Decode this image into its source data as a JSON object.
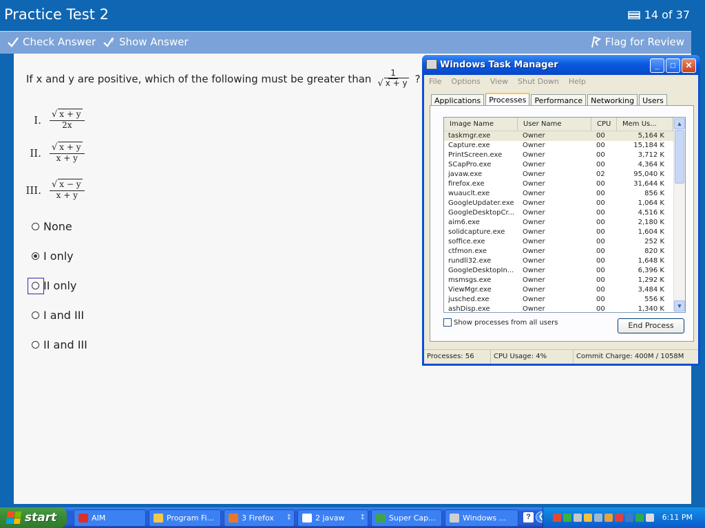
{
  "header": {
    "title": "Practice Test 2",
    "counter": "14 of 37"
  },
  "toolbar": {
    "check_answer": "Check Answer",
    "show_answer": "Show Answer",
    "flag_review": "Flag for Review"
  },
  "question": {
    "text": "If x and y are positive, which of the following must be greater than",
    "target_num": "1",
    "target_den": "x + y",
    "qmark": "?",
    "items": [
      {
        "label": "I.",
        "num": "x + y",
        "den": "2x"
      },
      {
        "label": "II.",
        "num": "x + y",
        "den": "x + y"
      },
      {
        "label": "III.",
        "num": "x − y",
        "den": "x + y"
      }
    ]
  },
  "choices": [
    {
      "label": "None",
      "selected": false
    },
    {
      "label": "I only",
      "selected": true
    },
    {
      "label": "II only",
      "selected": false
    },
    {
      "label": "I and III",
      "selected": false
    },
    {
      "label": "II and III",
      "selected": false
    }
  ],
  "taskmgr": {
    "title": "Windows Task Manager",
    "menu": [
      "File",
      "Options",
      "View",
      "Shut Down",
      "Help"
    ],
    "tabs": [
      "Applications",
      "Processes",
      "Performance",
      "Networking",
      "Users"
    ],
    "active_tab": "Processes",
    "columns": [
      "Image Name",
      "User Name",
      "CPU",
      "Mem Us..."
    ],
    "rows": [
      [
        "taskmgr.exe",
        "Owner",
        "00",
        "5,164 K"
      ],
      [
        "Capture.exe",
        "Owner",
        "00",
        "15,184 K"
      ],
      [
        "PrintScreen.exe",
        "Owner",
        "00",
        "3,712 K"
      ],
      [
        "SCapPro.exe",
        "Owner",
        "00",
        "4,364 K"
      ],
      [
        "javaw.exe",
        "Owner",
        "02",
        "95,040 K"
      ],
      [
        "firefox.exe",
        "Owner",
        "00",
        "31,644 K"
      ],
      [
        "wuauclt.exe",
        "Owner",
        "00",
        "856 K"
      ],
      [
        "GoogleUpdater.exe",
        "Owner",
        "00",
        "1,064 K"
      ],
      [
        "GoogleDesktopCr...",
        "Owner",
        "00",
        "4,516 K"
      ],
      [
        "aim6.exe",
        "Owner",
        "00",
        "2,180 K"
      ],
      [
        "solidcapture.exe",
        "Owner",
        "00",
        "1,604 K"
      ],
      [
        "soffice.exe",
        "Owner",
        "00",
        "252 K"
      ],
      [
        "ctfmon.exe",
        "Owner",
        "00",
        "820 K"
      ],
      [
        "rundll32.exe",
        "Owner",
        "00",
        "1,648 K"
      ],
      [
        "GoogleDesktopIn...",
        "Owner",
        "00",
        "6,396 K"
      ],
      [
        "msmsgs.exe",
        "Owner",
        "00",
        "1,292 K"
      ],
      [
        "ViewMgr.exe",
        "Owner",
        "00",
        "3,484 K"
      ],
      [
        "jusched.exe",
        "Owner",
        "00",
        "556 K"
      ],
      [
        "ashDisp.exe",
        "Owner",
        "00",
        "1,340 K"
      ]
    ],
    "show_all": "Show processes from all users",
    "end_process": "End Process",
    "status": {
      "processes": "Processes: 56",
      "cpu": "CPU Usage: 4%",
      "commit": "Commit Charge: 400M / 1058M"
    }
  },
  "taskbar": {
    "start": "start",
    "tasks": [
      {
        "label": "AIM",
        "icon": "aim-icon",
        "color": "#d9302a"
      },
      {
        "label": "Program Fi...",
        "icon": "folder-icon",
        "color": "#f2c94c"
      },
      {
        "label": "3 Firefox",
        "icon": "firefox-icon",
        "color": "#e8772e"
      },
      {
        "label": "2 javaw",
        "icon": "java-icon",
        "color": "#ffffff"
      },
      {
        "label": "Super Cap...",
        "icon": "capture-icon",
        "color": "#3fa34d"
      },
      {
        "label": "Windows ...",
        "icon": "taskmgr-icon",
        "color": "#cfcfcf"
      }
    ],
    "clock": "6:11 PM"
  }
}
